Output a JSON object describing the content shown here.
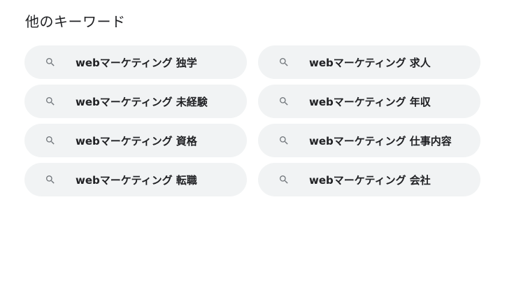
{
  "section": {
    "title": "他のキーワード"
  },
  "keywords": [
    {
      "label": "webマーケティング 独学",
      "icon": "search-icon"
    },
    {
      "label": "webマーケティング 求人",
      "icon": "search-icon"
    },
    {
      "label": "webマーケティング 未経験",
      "icon": "search-icon"
    },
    {
      "label": "webマーケティング 年収",
      "icon": "search-icon"
    },
    {
      "label": "webマーケティング 資格",
      "icon": "search-icon"
    },
    {
      "label": "webマーケティング 仕事内容",
      "icon": "search-icon"
    },
    {
      "label": "webマーケティング 転職",
      "icon": "search-icon"
    },
    {
      "label": "webマーケティング 会社",
      "icon": "search-icon"
    }
  ],
  "colors": {
    "chip_background": "#f1f3f4",
    "text": "#202124",
    "icon": "#70757a"
  }
}
